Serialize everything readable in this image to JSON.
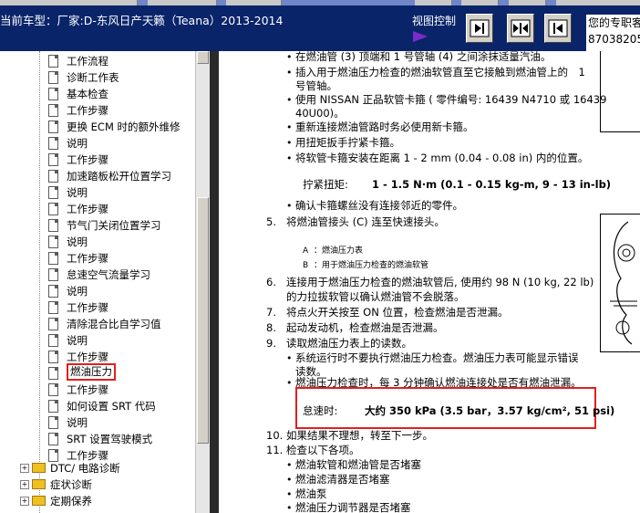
{
  "header": {
    "car_title": "当前车型：厂家:D-东风日产天籁（Teana）2013-2014",
    "view_control_label": "视图控制",
    "right_info": [
      "您的专职客",
      "87038205"
    ]
  },
  "sidebar": {
    "items": [
      "工作流程",
      "诊断工作表",
      "基本检查",
      "工作步骤",
      "更换 ECM 时的额外维修",
      "说明",
      "工作步骤",
      "加速踏板松开位置学习",
      "说明",
      "工作步骤",
      "节气门关闭位置学习",
      "说明",
      "工作步骤",
      "怠速空气流量学习",
      "说明",
      "工作步骤",
      "清除混合比自学习值",
      "说明",
      "工作步骤",
      "燃油压力",
      "工作步骤",
      "如何设置 SRT 代码",
      "说明",
      "SRT 设置驾驶模式",
      "工作步骤"
    ],
    "highlighted_item": "燃油压力",
    "folders": [
      "DTC/ 电路诊断",
      "症状诊断",
      "定期保养"
    ]
  },
  "content": {
    "lines": [
      "在燃油管 (3) 顶端和 1 号管轴 (4) 之间涂抹适量汽油。",
      "插入用于燃油压力检查的燃油软管直至它接触到燃油管上的　1",
      "号管轴。",
      "使用 NISSAN 正品软管卡箍 ( 零件编号: 16439 N4710 或 16439",
      "40U00)。",
      "重新连接燃油管路时务必使用新卡箍。",
      "用扭矩扳手拧紧卡箍。",
      "将软管卡箍安装在距离 1 - 2 mm (0.04 - 0.08 in) 内的位置。",
      "拧紧扭矩:",
      "1 - 1.5 N·m (0.1 - 0.15 kg-m, 9 - 13 in-lb)",
      "确认卡箍螺丝没有连接邻近的零件。",
      "5.",
      "将燃油管接头 (C) 连至快速接头。",
      "A",
      "：燃油压力表",
      "B",
      "：用于燃油压力检查的燃油软管",
      "6.",
      "连接用于燃油压力检查的燃油软管后, 使用约 98 N (10 kg, 22 lb)",
      "的力拉拔软管以确认燃油管不会脱落。",
      "7.",
      "将点火开关按至 ON 位置，检查燃油是否泄漏。",
      "8.",
      "起动发动机，检查燃油是否泄漏。",
      "9.",
      "读取燃油压力表上的读数。",
      "系统运行时不要执行燃油压力检查。燃油压力表可能显示错误",
      "读数。",
      "燃油压力检查时，每 3 分钟确认燃油连接处是否有燃油泄漏。",
      "怠速时:",
      "大约 350 kPa (3.5 bar，3.57 kg/cm², 51 psi)",
      "10.",
      "如果结果不理想，转至下一步。",
      "11.",
      "检查以下各项。",
      "燃油软管和燃油管是否堵塞",
      "燃油滤清器是否堵塞",
      "燃油泵",
      "燃油压力调节器是否堵塞"
    ]
  }
}
